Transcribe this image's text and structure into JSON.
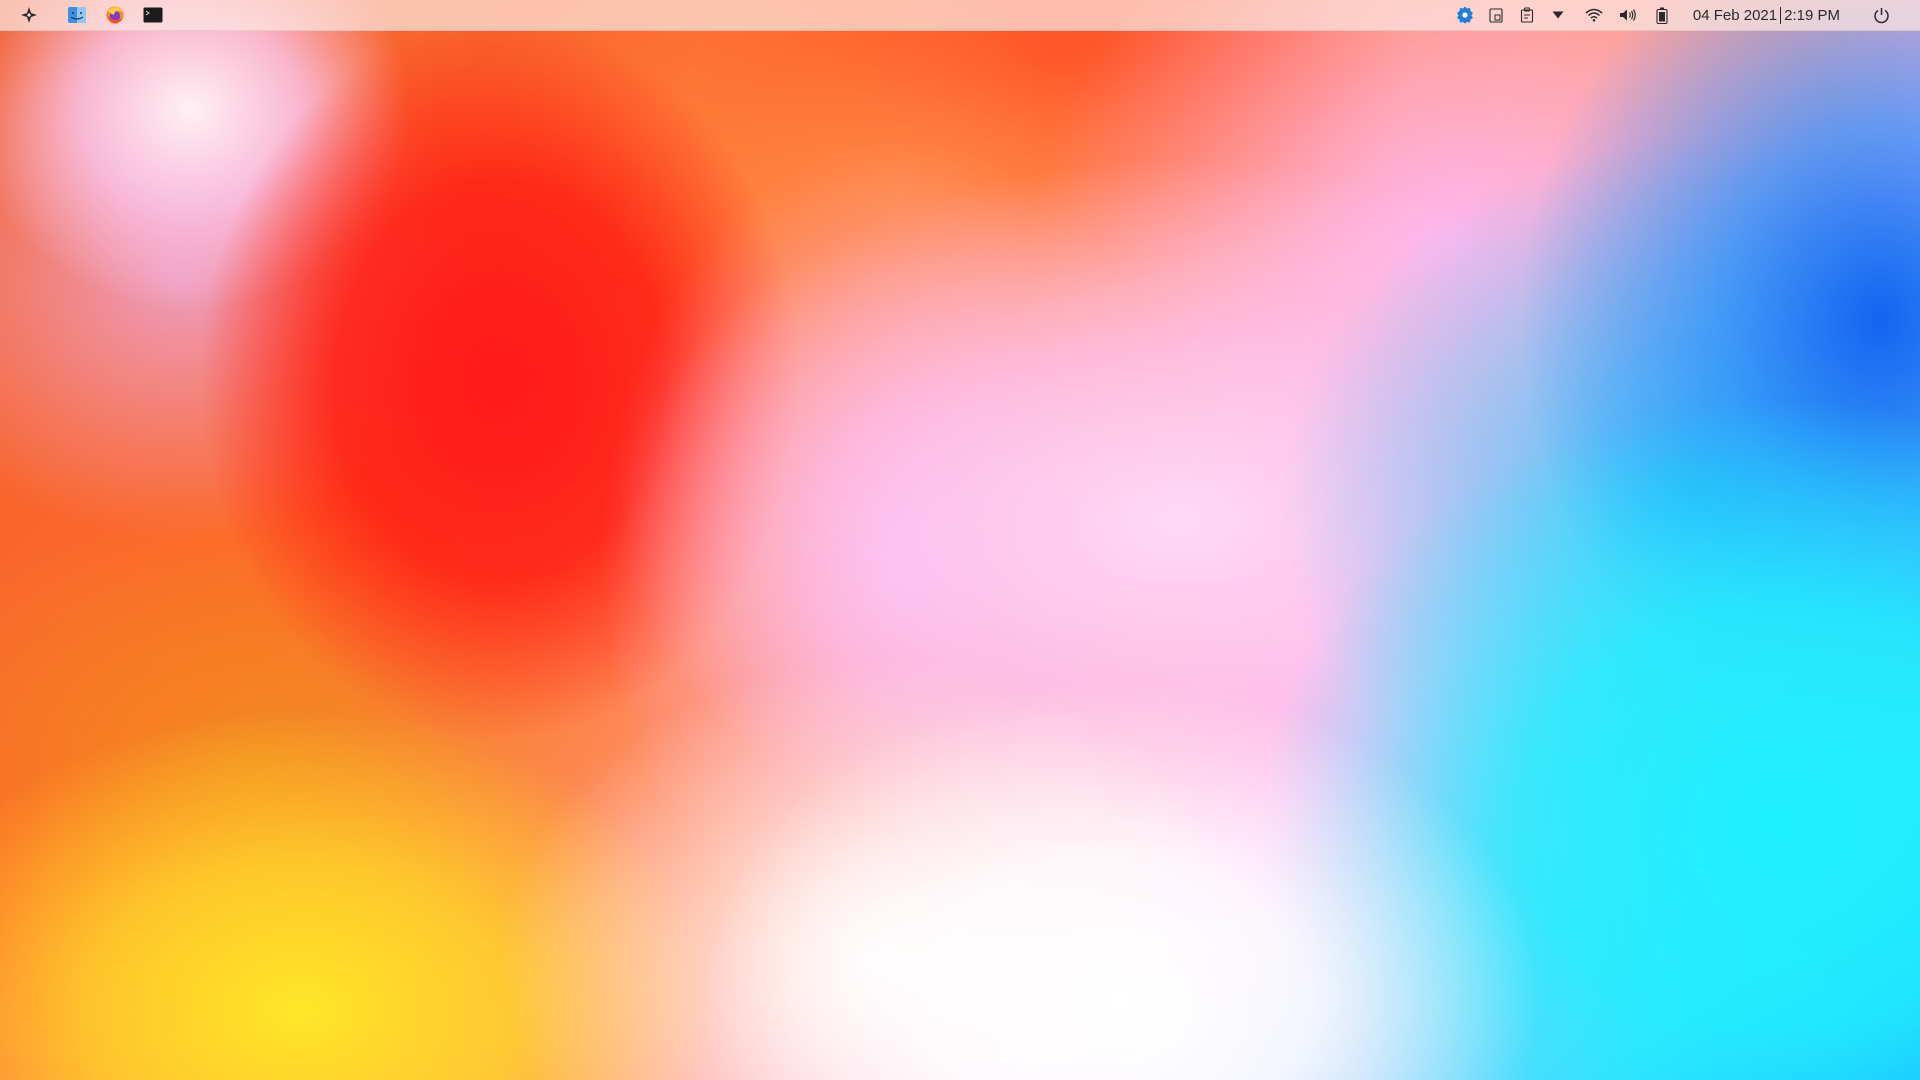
{
  "topbar": {
    "apps": [
      {
        "name": "application-launcher",
        "icon": "launcher-icon"
      },
      {
        "name": "finder",
        "icon": "finder-icon"
      },
      {
        "name": "firefox",
        "icon": "firefox-icon"
      },
      {
        "name": "terminal",
        "icon": "terminal-icon"
      }
    ],
    "tray": [
      {
        "name": "settings-status",
        "icon": "gear-badge-icon",
        "color": "#1e7fd6"
      },
      {
        "name": "clipboard",
        "icon": "clipboard-icon"
      },
      {
        "name": "updates",
        "icon": "package-icon"
      },
      {
        "name": "expand-tray",
        "icon": "caret-down-icon"
      },
      {
        "name": "network",
        "icon": "wifi-icon"
      },
      {
        "name": "volume",
        "icon": "speaker-icon"
      },
      {
        "name": "battery",
        "icon": "battery-icon"
      }
    ],
    "clock": {
      "date": "04 Feb 2021",
      "time": "2:19 PM"
    },
    "power": {
      "icon": "power-icon"
    }
  },
  "colors": {
    "icon_dark": "#2a2a2e",
    "accent_blue": "#1e7fd6",
    "panel_background": "#fce6e0"
  }
}
